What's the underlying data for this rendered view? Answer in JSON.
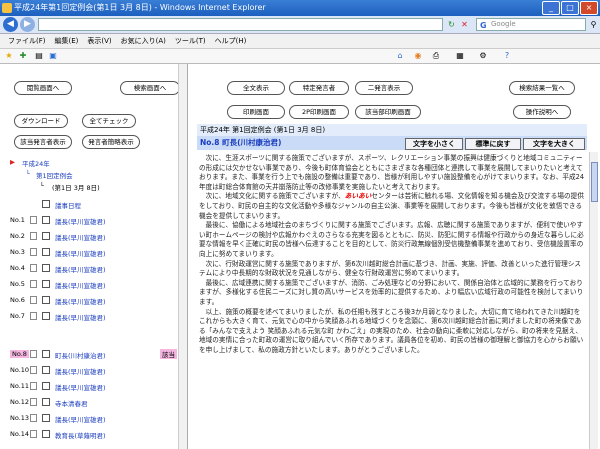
{
  "window": {
    "title": "平成24年第1回定例会(第1日 3月 8日) - Windows Internet Explorer",
    "search_placeholder": "Google",
    "google_mark": "G"
  },
  "menu": [
    "ファイル(F)",
    "編集(E)",
    "表示(V)",
    "お気に入り(A)",
    "ツール(T)",
    "ヘルプ(H)"
  ],
  "left": {
    "buttons": {
      "list_screen": "閲覧画面へ",
      "search_screen": "検索画面へ",
      "download": "ダウンロード",
      "check_all": "全てチェック",
      "show_speakers": "該当発言者表示",
      "speaker_hide": "発言者簡略表示"
    },
    "tree": {
      "year": "平成24年",
      "session": "第1回定例会",
      "day": "(第1日 3月 8日)"
    },
    "speakers": [
      {
        "no": "",
        "name": "議事日程",
        "mark": ""
      },
      {
        "no": "No.1",
        "name": "議長(早川宣雄君)",
        "mark": ""
      },
      {
        "no": "No.2",
        "name": "議長(早川宣雄君)",
        "mark": ""
      },
      {
        "no": "No.3",
        "name": "議長(早川宣雄君)",
        "mark": ""
      },
      {
        "no": "No.4",
        "name": "議長(早川宣雄君)",
        "mark": ""
      },
      {
        "no": "No.5",
        "name": "議長(早川宣雄君)",
        "mark": ""
      },
      {
        "no": "No.6",
        "name": "議長(早川宣雄君)",
        "mark": ""
      },
      {
        "no": "No.7",
        "name": "議長(早川宣雄君)",
        "mark": ""
      },
      {
        "no": "No.8",
        "name": "町長(川村康治君)",
        "mark": "該当"
      },
      {
        "no": "No.10",
        "name": "議長(早川宣雄君)",
        "mark": ""
      },
      {
        "no": "No.11",
        "name": "議長(早川宣雄君)",
        "mark": ""
      },
      {
        "no": "No.12",
        "name": "寺本清春君",
        "mark": ""
      },
      {
        "no": "No.13",
        "name": "議長(早川宣雄君)",
        "mark": ""
      },
      {
        "no": "No.14",
        "name": "教育長(草薙明君)",
        "mark": ""
      }
    ]
  },
  "right": {
    "buttons": {
      "show_all": "全文表示",
      "specific_speaker": "特定発言者",
      "two_speakers": "二発言表示",
      "search_list": "検索結果一覧へ",
      "print": "印刷画面",
      "print_2p": "2P印刷画面",
      "print_hit": "該当部印刷画面",
      "help": "操作説明へ"
    },
    "header": "平成24年 第1回定例会 (第1日 3月 8日)",
    "speaker": "No.8 町長(川村康治君)",
    "size_buttons": [
      "文字を小さく",
      "標準に戻す",
      "文字を大きく"
    ],
    "paragraphs": [
      "次に、生涯スポーツに関する施策でございますが、スポーツ、レクリエーション事業の振興は健康づくりと地域コミュニティーの形成には欠かせない事業であり、今後も町体育協会とともにさまざまな各種団体と連携して事業を展開してまいりたいと考えております。また、事業を行う上でも施設の整備は重要であり、皆様が利用しやすい施設整備を心がけてまいります。なお、平成24年度は町総合体育館の天井崩落防止等の改修事業を実施したいと考えております。",
      "次に、地域文化に関する施策でございますが、",
      "センターは芸術に触れる場、文化情報を知る機会及び交流する場の提供をしており、町民の自主的な文化活動や多様なジャンルの自主公演、事業等を展開しております。今後も皆様が文化を敦悟できる機会を提供してまいります。",
      "最後に、協働による地域社会のまちづくりに関する施策でございます。広報、広聴に関する施策でありますが、便利で使いやすい町ホームページの検討や広報かわぐえのさらなる充実を図るとともに、防災、防犯に関する情報や行政からの身近な暮らしに必要な情報を早く正確に町民の皆様へ伝達することを目的として、防災行政無線個別受信機整備事業を進めており、受信機設置率の向上に努めてまいります。",
      "次に、行財政運営に関する施策でありますが、第6次川越町総合計画に基づき、計画、実施、評価、改善といった進行管理システムにより中長期的な財政状況を見通しながら、健全な行財政運営に努めてまいります。",
      "最後に、広域連携に関する施策でございますが、消防、ごみ処理などの分野において、関係自治体と広域的に業務を行っておりますが、多様化する住民ニーズに対し質の高いサービスを効率的に提供するため、より幅広い広域行政の可能性を検討してまいります。",
      "以上、施策の概要を述べてまいりましたが、私の任期も残すところ後3か月弱となりました。大切に育て培われてきた川越町をこれからも大きく育て、元気で心の中から笑顔あふれる地域づくりを念頭に、第6次川越町総合計画に掲げました町の将来像である「みんなで支えよう 笑顔あふれる元気な町 かわごえ」の実現のため、社会の動向に柔軟に対応しながら、町の将来を見据え、地域の実情に合った町政の運営に取り組んでいく所存であります。議員各位を初め、町民の皆様の御理解と御協力を心からお願いを申し上げまして、私の施政方針といたします。ありがとうございました。"
    ],
    "highlight": "あいあい"
  }
}
